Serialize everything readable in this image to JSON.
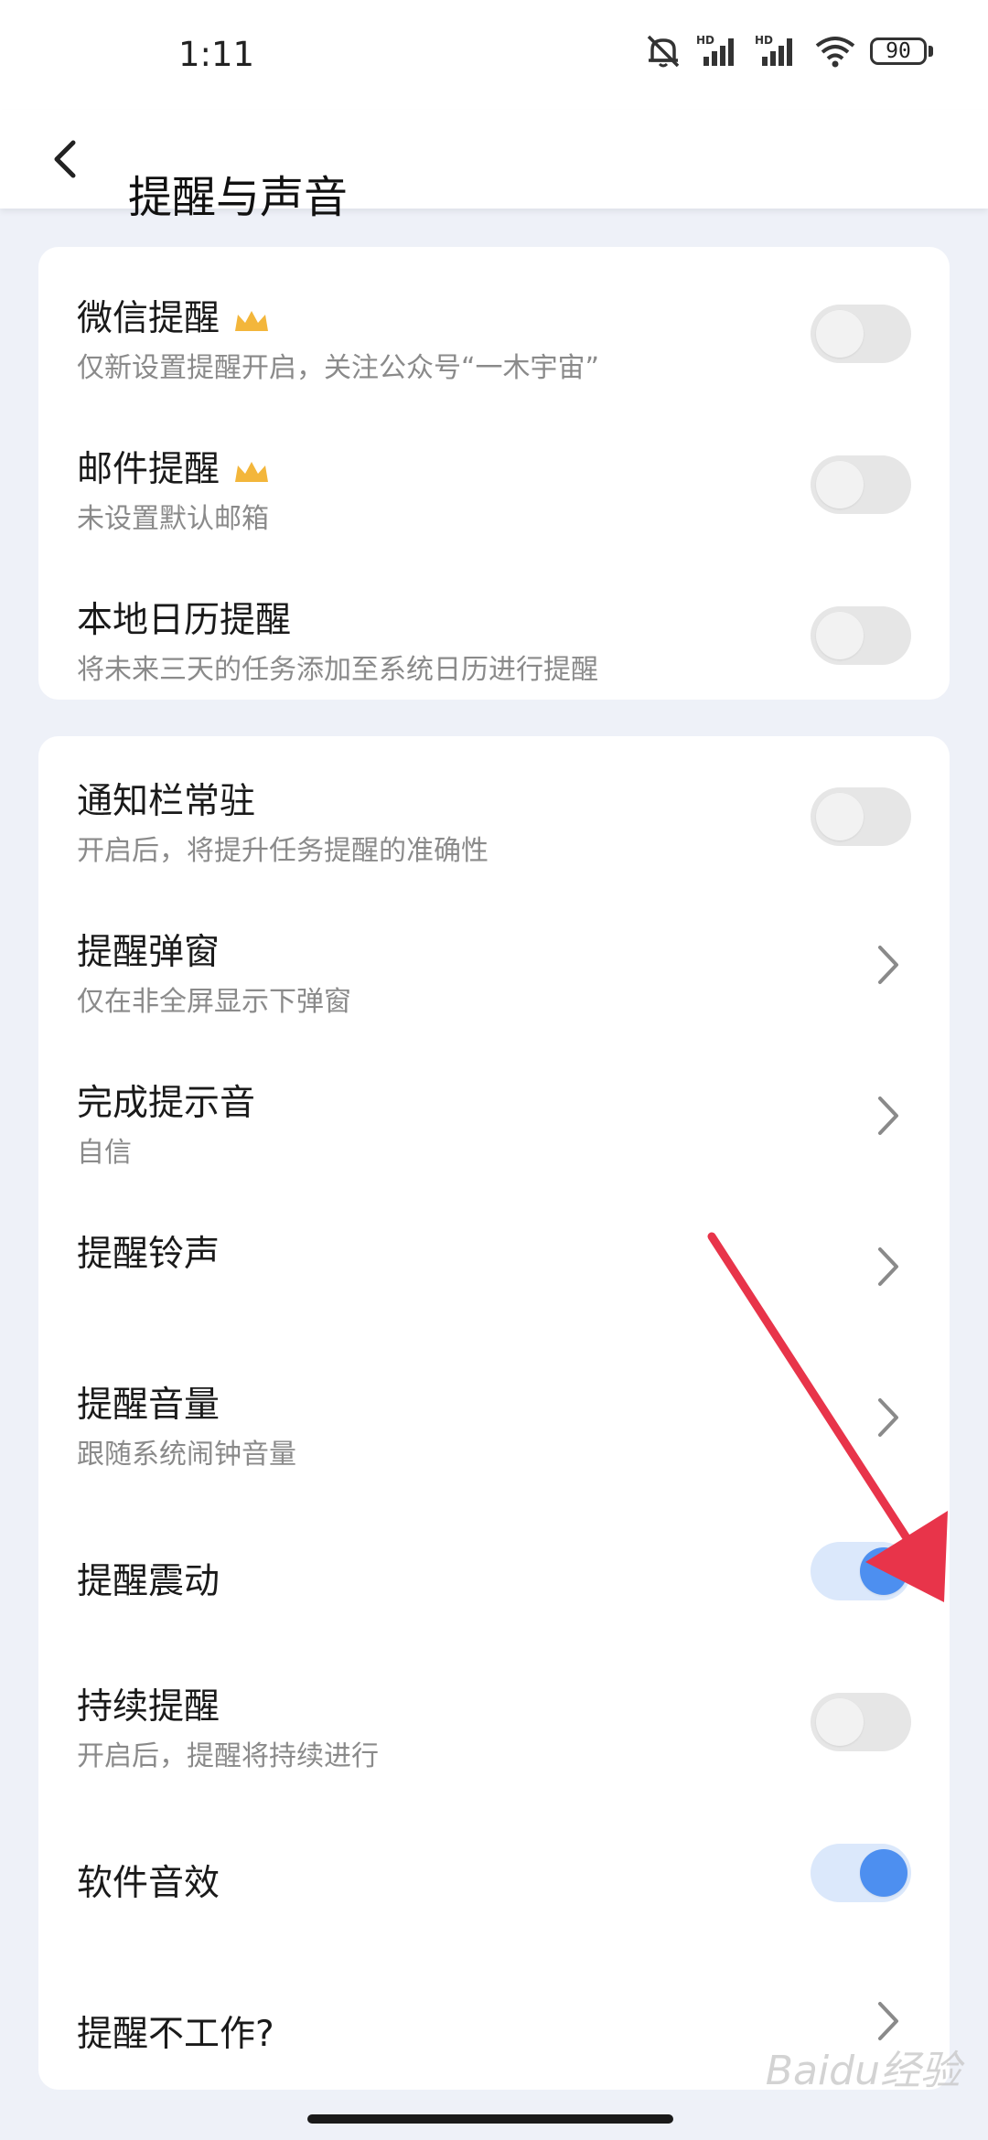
{
  "status_bar": {
    "time": "1:11",
    "battery": "90"
  },
  "header": {
    "title": "提醒与声音"
  },
  "group1": {
    "items": [
      {
        "label": "微信提醒",
        "sub": "仅新设置提醒开启，关注公众号“一木宇宙”",
        "toggle_on": false
      },
      {
        "label": "邮件提醒",
        "sub": "未设置默认邮箱",
        "toggle_on": false
      },
      {
        "label": "本地日历提醒",
        "sub": "将未来三天的任务添加至系统日历进行提醒",
        "toggle_on": false
      }
    ]
  },
  "group2": {
    "items": [
      {
        "label": "通知栏常驻",
        "sub": "开启后，将提升任务提醒的准确性",
        "toggle_on": false
      },
      {
        "label": "提醒弹窗",
        "sub": "仅在非全屏显示下弹窗"
      },
      {
        "label": "完成提示音",
        "sub": "自信"
      },
      {
        "label": "提醒铃声"
      },
      {
        "label": "提醒音量",
        "sub": "跟随系统闹钟音量"
      },
      {
        "label": "提醒震动",
        "toggle_on": true
      },
      {
        "label": "持续提醒",
        "sub": "开启后，提醒将持续进行",
        "toggle_on": false
      },
      {
        "label": "软件音效",
        "toggle_on": true
      },
      {
        "label": "提醒不工作?"
      }
    ]
  },
  "watermark": "Baidu经验",
  "colors": {
    "accent": "#4d8ff0",
    "arrow": "#e8344a",
    "crown": "#f3b63b"
  }
}
